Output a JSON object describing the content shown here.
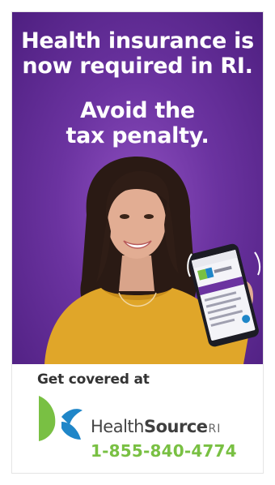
{
  "hero": {
    "headline_line1": "Health insurance is",
    "headline_line2": "now required in RI.",
    "subhead_line1": "Avoid the",
    "subhead_line2": "tax penalty."
  },
  "footer": {
    "cta": "Get covered at",
    "brand_health": "Health",
    "brand_source": "Source",
    "brand_ri": "RI",
    "phone": "1-855-840-4774"
  },
  "colors": {
    "purple_bg": "#6b33a0",
    "shirt": "#e0a629",
    "brand_green": "#79c043",
    "brand_blue": "#1f86c8"
  }
}
